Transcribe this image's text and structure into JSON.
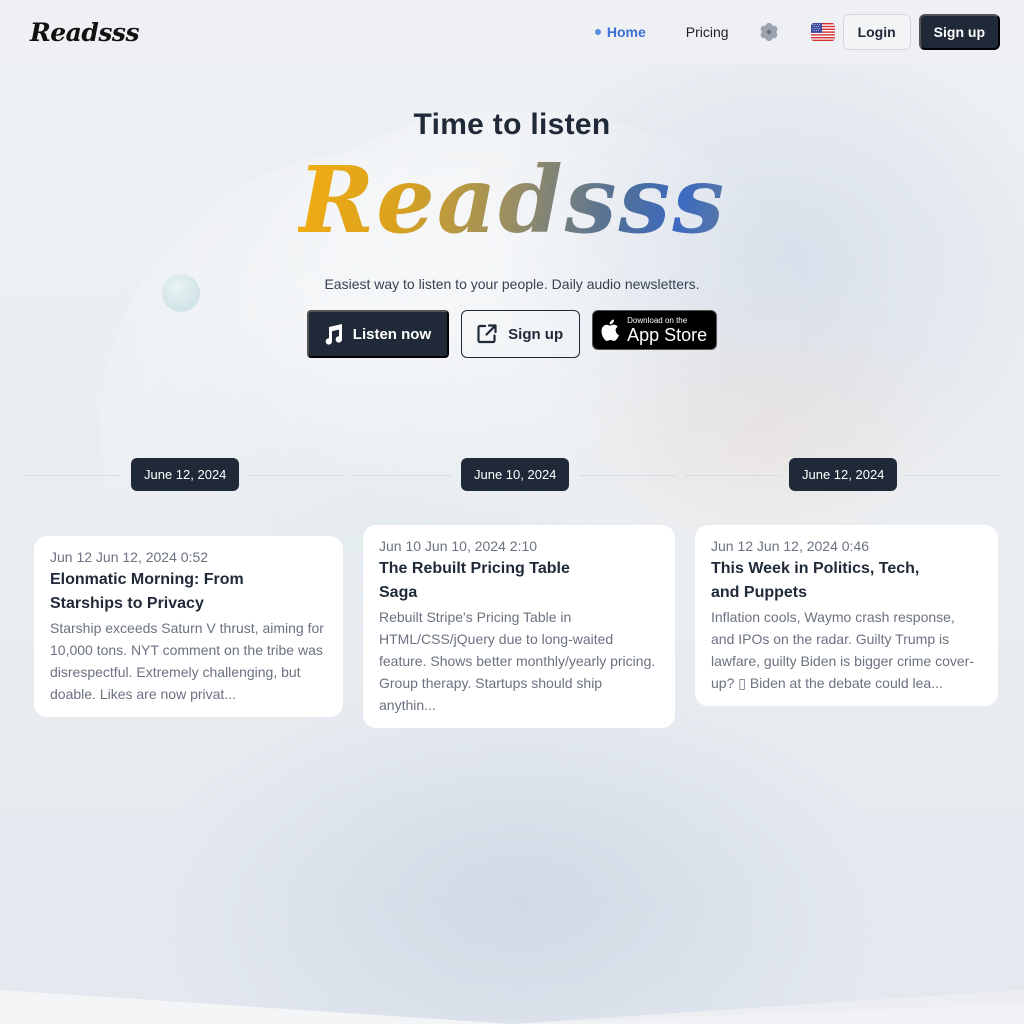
{
  "header": {
    "logo": "Readsss",
    "nav": [
      {
        "label": "Home",
        "active": true
      },
      {
        "label": "Pricing",
        "active": false
      }
    ],
    "settings_icon": "gear-icon",
    "language_icon": "us-flag-icon",
    "login_label": "Login",
    "signup_label": "Sign up"
  },
  "hero": {
    "title": "Time to listen",
    "brand": "Readsss",
    "subtitle": "Easiest way to listen to your people. Daily audio newsletters.",
    "listen_label": "Listen now",
    "signup_label": "Sign up",
    "appstore_small": "Download on the",
    "appstore_big": "App Store"
  },
  "columns": [
    {
      "date": "June 12, 2024",
      "card": {
        "meta": "Jun 12 Jun 12, 2024 0:52",
        "title": "Elonmatic Morning: From Starships to Privacy",
        "description": "Starship exceeds Saturn V thrust, aiming for 10,000 tons. NYT comment on the tribe was disrespectful. Extremely challenging, but doable. Likes are now privat..."
      }
    },
    {
      "date": "June 10, 2024",
      "card": {
        "meta": "Jun 10 Jun 10, 2024 2:10",
        "title": "The Rebuilt Pricing Table Saga",
        "description": "Rebuilt Stripe's Pricing Table in HTML/CSS/jQuery due to long-waited feature. Shows better monthly/yearly pricing. Group therapy. Startups should ship anythin..."
      }
    },
    {
      "date": "June 12, 2024",
      "card": {
        "meta": "Jun 12 Jun 12, 2024 0:46",
        "title": "This Week in Politics, Tech, and Puppets",
        "description": "Inflation cools, Waymo crash response, and IPOs on the radar. Guilty Trump is lawfare, guilty Biden is bigger crime cover-up? ▯ Biden at the debate could lea..."
      }
    }
  ],
  "colors": {
    "primary_dark": "#1f2937",
    "accent_blue": "#3b6fd4",
    "brand_gradient_start": "#f3ad12",
    "brand_gradient_end": "#3d6ac0"
  }
}
